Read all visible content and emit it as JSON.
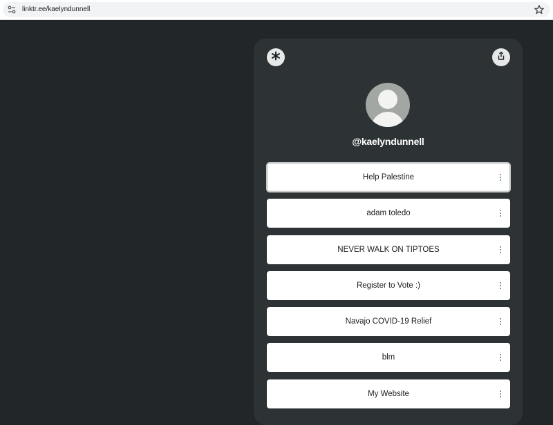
{
  "browser": {
    "url": "linktr.ee/kaelyndunnell",
    "site_info_icon": "tune-icon",
    "bookmark_icon": "star-outline-icon"
  },
  "profile": {
    "handle": "@kaelyndunnell",
    "avatar_icon": "default-avatar",
    "top_left_icon": "linktree-logo-icon",
    "top_right_icon": "share-icon"
  },
  "links": [
    {
      "label": "Help Palestine",
      "focused": true
    },
    {
      "label": "adam toledo"
    },
    {
      "label": "NEVER WALK ON TIPTOES"
    },
    {
      "label": "Register to Vote :)"
    },
    {
      "label": "Navajo COVID-19 Relief"
    },
    {
      "label": "blm"
    },
    {
      "label": "My Website"
    }
  ],
  "colors": {
    "page_bg": "#232628",
    "card_bg": "#2d3335",
    "button_bg": "#ffffff",
    "text": "#1b1d1e"
  }
}
